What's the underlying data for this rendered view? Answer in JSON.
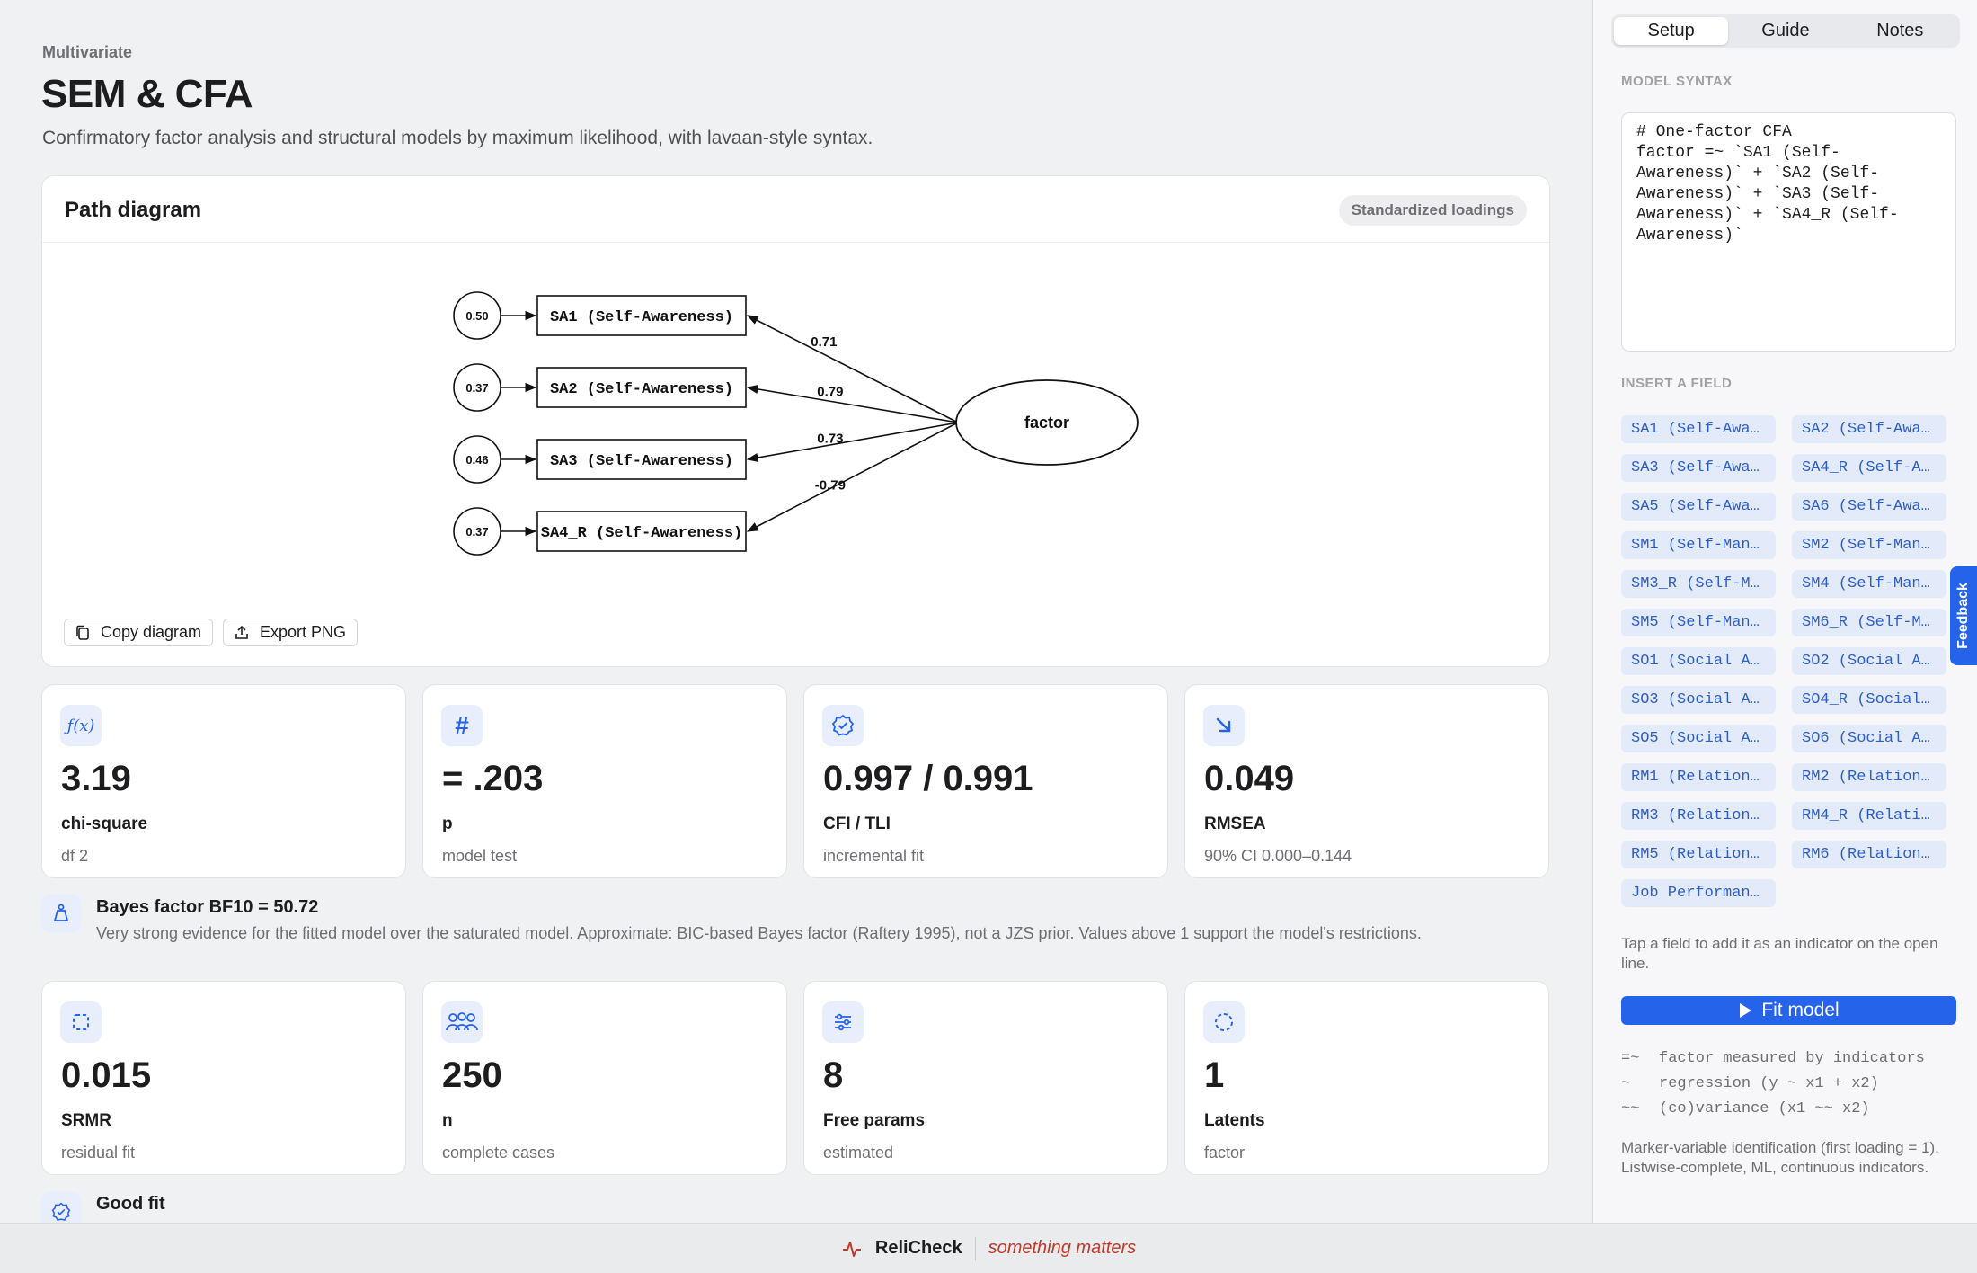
{
  "header": {
    "breadcrumb": "Multivariate",
    "title": "SEM & CFA",
    "subtitle": "Confirmatory factor analysis and structural models by maximum likelihood, with lavaan-style syntax."
  },
  "diagram": {
    "title": "Path diagram",
    "badge": "Standardized loadings",
    "latent": "factor",
    "indicators": [
      {
        "label": "SA1 (Self-Awareness)",
        "error": "0.50",
        "loading": "0.71"
      },
      {
        "label": "SA2 (Self-Awareness)",
        "error": "0.37",
        "loading": "0.79"
      },
      {
        "label": "SA3 (Self-Awareness)",
        "error": "0.46",
        "loading": "0.73"
      },
      {
        "label": "SA4_R (Self-Awareness)",
        "error": "0.37",
        "loading": "-0.79"
      }
    ],
    "copy_label": "Copy diagram",
    "export_label": "Export PNG"
  },
  "stats_row1": [
    {
      "icon": "function-icon",
      "value": "3.19",
      "label": "chi-square",
      "sub": "df 2"
    },
    {
      "icon": "hash-icon",
      "value": "= .203",
      "label": "p",
      "sub": "model test"
    },
    {
      "icon": "badge-check-icon",
      "value": "0.997 / 0.991",
      "label": "CFI / TLI",
      "sub": "incremental fit"
    },
    {
      "icon": "arrow-down-right-icon",
      "value": "0.049",
      "label": "RMSEA",
      "sub": "90% CI 0.000–0.144"
    }
  ],
  "bayes": {
    "title": "Bayes factor BF10 = 50.72",
    "text": "Very strong evidence for the fitted model over the saturated model. Approximate: BIC-based Bayes factor (Raftery 1995), not a JZS prior. Values above 1 support the model's restrictions."
  },
  "stats_row2": [
    {
      "icon": "dashed-square-icon",
      "value": "0.015",
      "label": "SRMR",
      "sub": "residual fit"
    },
    {
      "icon": "users-icon",
      "value": "250",
      "label": "n",
      "sub": "complete cases"
    },
    {
      "icon": "sliders-icon",
      "value": "8",
      "label": "Free params",
      "sub": "estimated"
    },
    {
      "icon": "dashed-circle-icon",
      "value": "1",
      "label": "Latents",
      "sub": "factor"
    }
  ],
  "goodfit": {
    "title": "Good fit"
  },
  "panel": {
    "tabs": [
      "Setup",
      "Guide",
      "Notes"
    ],
    "syntax_label": "MODEL SYNTAX",
    "syntax": "# One-factor CFA\nfactor =~ `SA1 (Self-\nAwareness)` + `SA2 (Self-\nAwareness)` + `SA3 (Self-\nAwareness)` + `SA4_R (Self-\nAwareness)`",
    "insert_label": "INSERT A FIELD",
    "fields": [
      "SA1 (Self-Awa…",
      "SA2 (Self-Awa…",
      "SA3 (Self-Awa…",
      "SA4_R (Self-A…",
      "SA5 (Self-Awa…",
      "SA6 (Self-Awa…",
      "SM1 (Self-Man…",
      "SM2 (Self-Man…",
      "SM3_R (Self-M…",
      "SM4 (Self-Man…",
      "SM5 (Self-Man…",
      "SM6_R (Self-M…",
      "SO1 (Social A…",
      "SO2 (Social A…",
      "SO3 (Social A…",
      "SO4_R (Social…",
      "SO5 (Social A…",
      "SO6 (Social A…",
      "RM1 (Relation…",
      "RM2 (Relation…",
      "RM3 (Relation…",
      "RM4_R (Relati…",
      "RM5 (Relation…",
      "RM6 (Relation…",
      "Job Performan…"
    ],
    "help": "Tap a field to add it as an indicator on the open line.",
    "fit_label": "Fit model",
    "legend": [
      {
        "op": "=~",
        "desc": "factor measured by indicators"
      },
      {
        "op": "~",
        "desc": "regression (y ~ x1 + x2)"
      },
      {
        "op": "~~",
        "desc": "(co)variance (x1 ~~ x2)"
      }
    ],
    "fine": "Marker-variable identification (first loading = 1). Listwise-complete, ML, continuous indicators.",
    "feedback": "Feedback"
  },
  "footer": {
    "brand": "ReliCheck",
    "tagline": "something matters"
  },
  "colors": {
    "accent": "#2563eb",
    "chip_bg": "#e3ebfb",
    "tagline": "#c0392b"
  }
}
